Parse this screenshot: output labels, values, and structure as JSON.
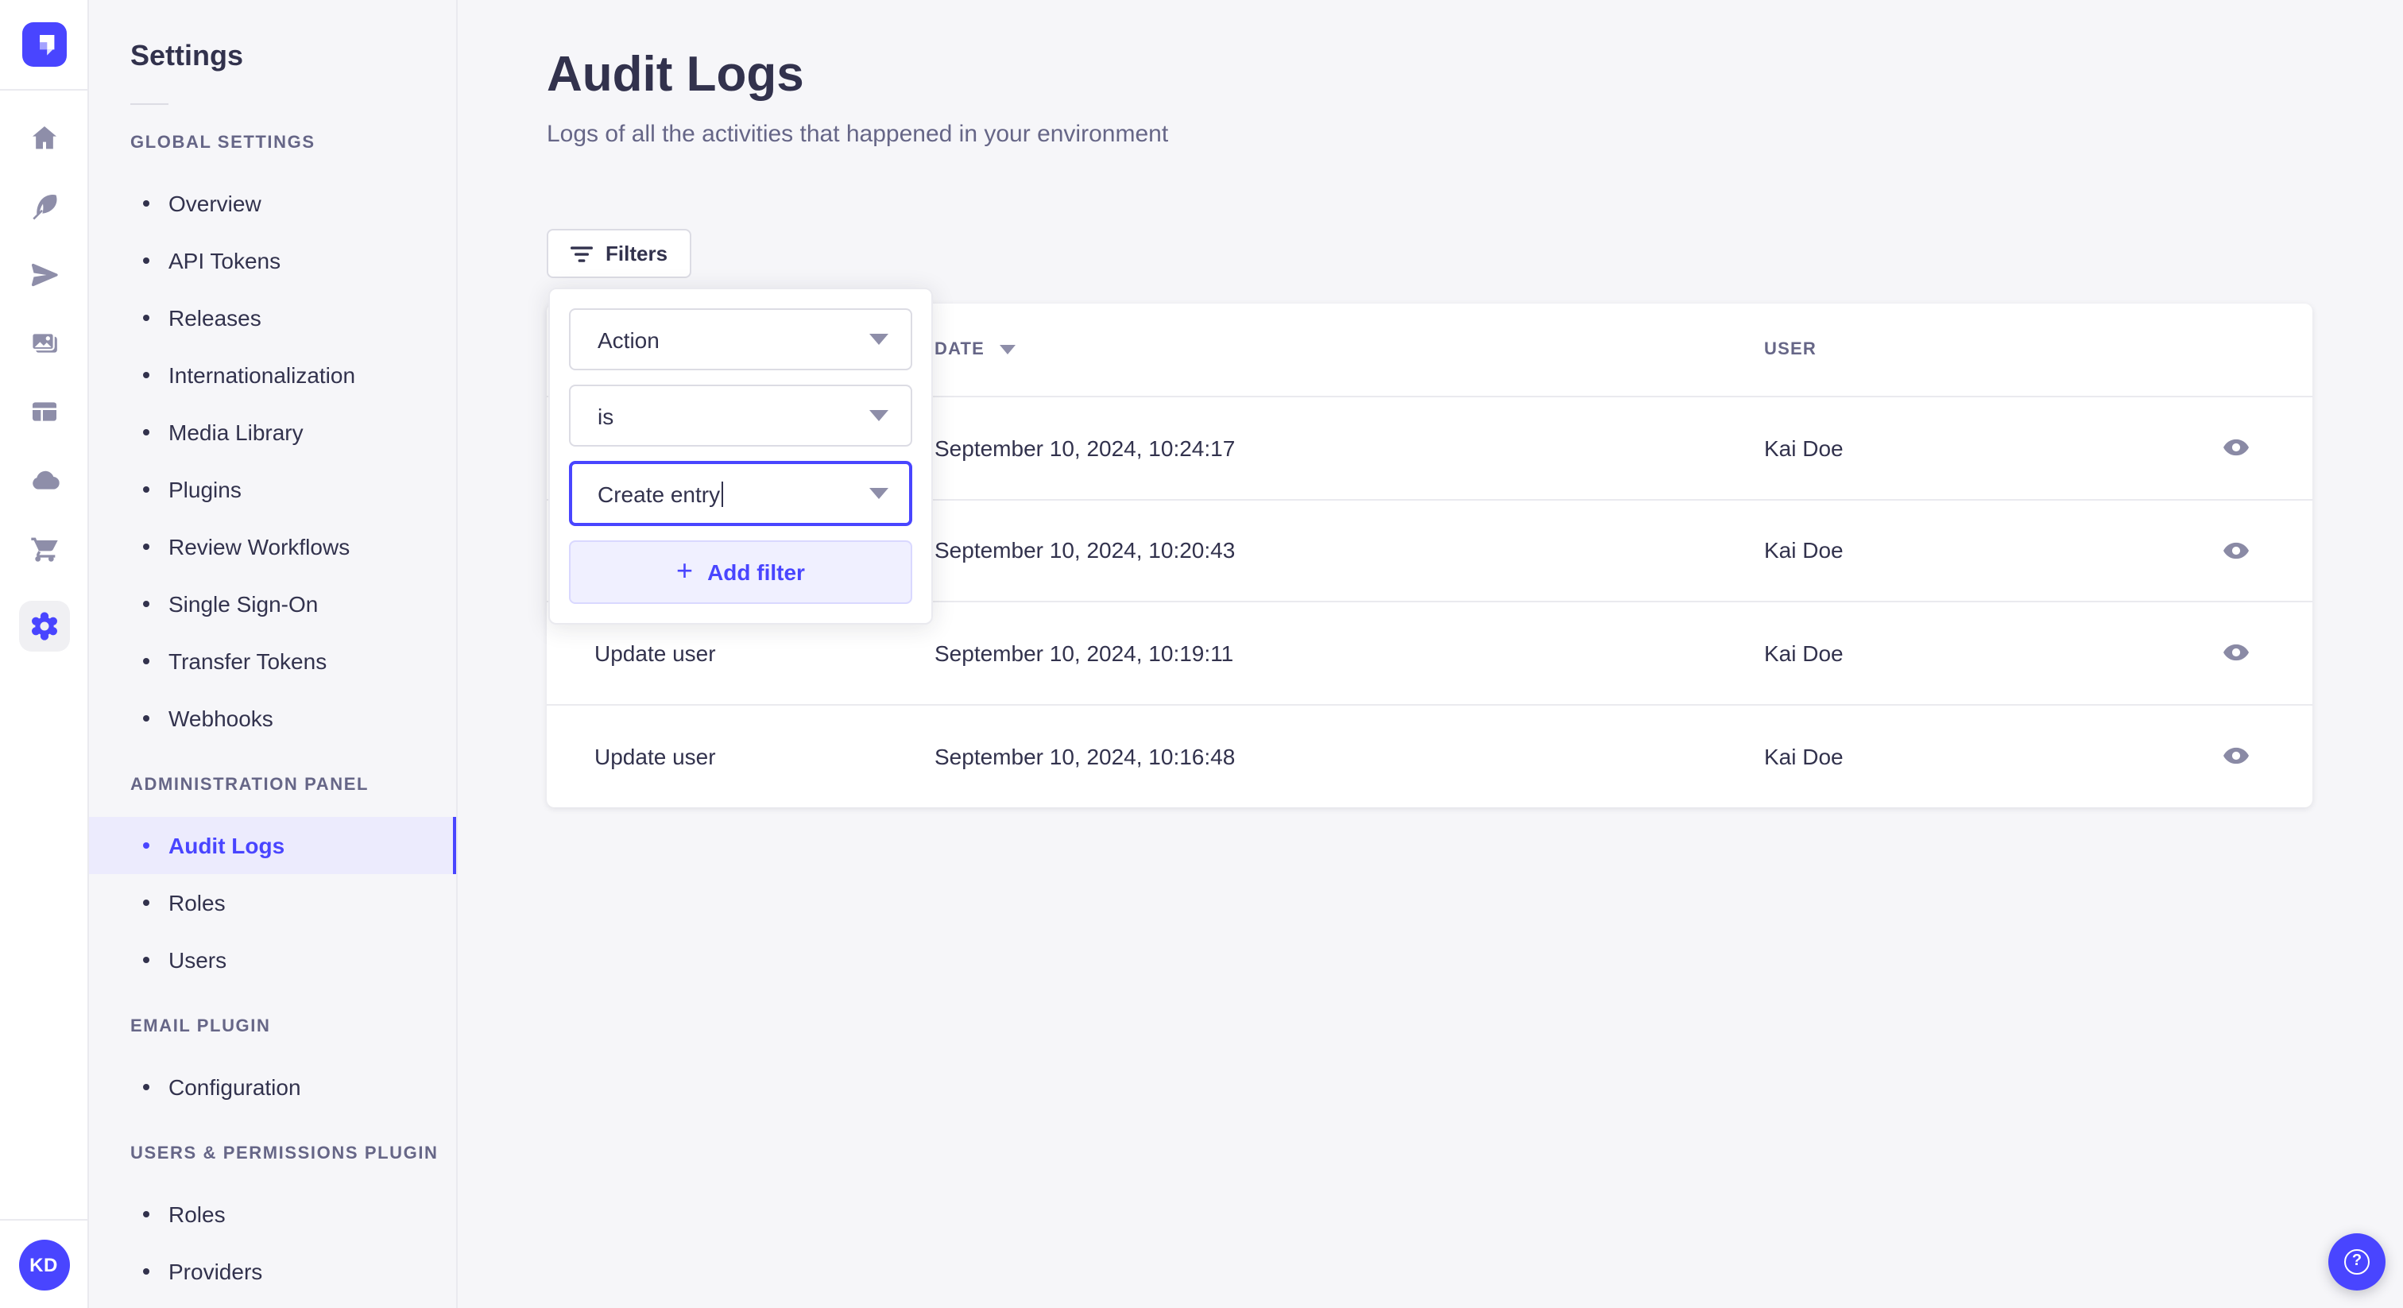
{
  "accent_color": "#4945FF",
  "rail": {
    "icons": [
      "home",
      "feather",
      "paper-plane",
      "media-library",
      "layout",
      "cloud",
      "cart",
      "settings-gear"
    ],
    "active_icon": "settings-gear"
  },
  "avatar": {
    "initials": "KD"
  },
  "sidebar": {
    "title": "Settings",
    "sections": [
      {
        "label": "GLOBAL SETTINGS",
        "items": [
          "Overview",
          "API Tokens",
          "Releases",
          "Internationalization",
          "Media Library",
          "Plugins",
          "Review Workflows",
          "Single Sign-On",
          "Transfer Tokens",
          "Webhooks"
        ]
      },
      {
        "label": "ADMINISTRATION PANEL",
        "items": [
          "Audit Logs",
          "Roles",
          "Users"
        ],
        "selected_item": "Audit Logs"
      },
      {
        "label": "EMAIL PLUGIN",
        "items": [
          "Configuration"
        ]
      },
      {
        "label": "USERS & PERMISSIONS PLUGIN",
        "items": [
          "Roles",
          "Providers"
        ]
      }
    ]
  },
  "page": {
    "title": "Audit Logs",
    "subtitle": "Logs of all the activities that happened in your environment"
  },
  "toolbar": {
    "filters_label": "Filters"
  },
  "filter_popover": {
    "field_value": "Action",
    "operator_value": "is",
    "value_input": "Create entry",
    "add_filter_label": "Add filter"
  },
  "table": {
    "columns": {
      "action": "",
      "date": "DATE",
      "user": "USER"
    },
    "sorted_column": "DATE",
    "rows": [
      {
        "action": "",
        "date": "September 10, 2024, 10:24:17",
        "user": "Kai Doe"
      },
      {
        "action": "",
        "date": "September 10, 2024, 10:20:43",
        "user": "Kai Doe"
      },
      {
        "action": "Update user",
        "date": "September 10, 2024, 10:19:11",
        "user": "Kai Doe"
      },
      {
        "action": "Update user",
        "date": "September 10, 2024, 10:16:48",
        "user": "Kai Doe"
      }
    ]
  },
  "help": {
    "label": "?"
  }
}
